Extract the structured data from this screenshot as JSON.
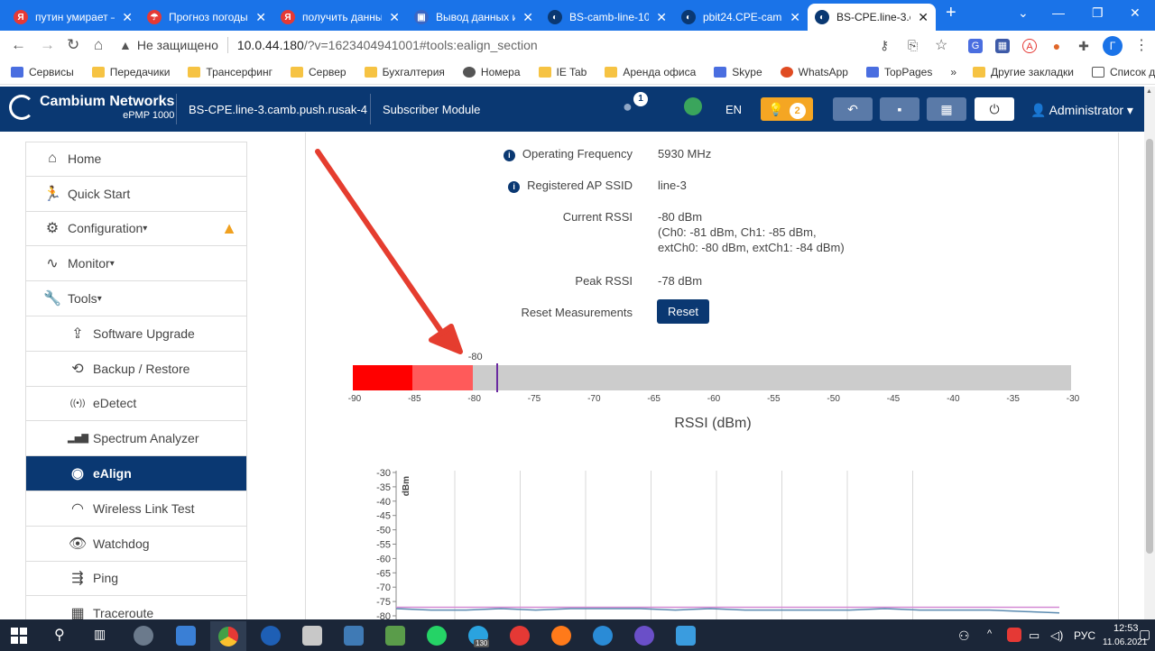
{
  "browser": {
    "tabs": [
      {
        "title": "путин умирает –",
        "icon": "yandex-icon",
        "color": "#e53935"
      },
      {
        "title": "Прогноз погоды",
        "icon": "umbrella-icon",
        "color": "#e53935"
      },
      {
        "title": "получить данны",
        "icon": "yandex-icon",
        "color": "#e53935"
      },
      {
        "title": "Вывод данных и",
        "icon": "site-icon",
        "color": "#3a66c4"
      },
      {
        "title": "BS-camb-line-10",
        "icon": "cambium-icon",
        "color": "#0a3872"
      },
      {
        "title": "pbit24.CPE-camb",
        "icon": "cambium-icon",
        "color": "#0a3872"
      },
      {
        "title": "BS-CPE.line-3.cam",
        "icon": "cambium-icon",
        "color": "#0a3872"
      }
    ],
    "address": {
      "security": "Не защищено",
      "host": "10.0.44.180",
      "path": "/?v=1623404941001#tools:ealign_section"
    },
    "profile_initial": "Г",
    "bookmarks": [
      {
        "label": "Сервисы",
        "icon": "apps-grid-icon"
      },
      {
        "label": "Передачики",
        "icon": "folder-icon"
      },
      {
        "label": "Трансерфинг",
        "icon": "folder-icon"
      },
      {
        "label": "Сервер",
        "icon": "folder-icon"
      },
      {
        "label": "Бухгалтерия",
        "icon": "folder-icon"
      },
      {
        "label": "Номера",
        "icon": "globe-icon"
      },
      {
        "label": "IE Tab",
        "icon": "folder-icon"
      },
      {
        "label": "Аренда офиса",
        "icon": "folder-icon"
      },
      {
        "label": "Skype",
        "icon": "windows-icon"
      },
      {
        "label": "WhatsApp",
        "icon": "alert-circle-icon"
      },
      {
        "label": "TopPages",
        "icon": "apps-grid-icon"
      }
    ],
    "bookmarks_more": "»",
    "bookmarks_other": "Другие закладки",
    "reading_list": "Список для чтения"
  },
  "header": {
    "brand_line1": "Cambium Networks",
    "brand_line2": "ePMP 1000",
    "device_name": "BS-CPE.line-3.camb.push.rusak-4",
    "mode": "Subscriber Module",
    "user_badge": "1",
    "language": "EN",
    "alerts_count": "2",
    "user": "Administrator"
  },
  "sidebar": {
    "items": [
      {
        "label": "Home",
        "icon": "home-icon",
        "level": "top"
      },
      {
        "label": "Quick Start",
        "icon": "running-person-icon",
        "level": "top"
      },
      {
        "label": "Configuration",
        "icon": "gear-icon",
        "level": "top",
        "caret": true,
        "warning": true
      },
      {
        "label": "Monitor",
        "icon": "pulse-icon",
        "level": "top",
        "caret": true
      },
      {
        "label": "Tools",
        "icon": "wrench-icon",
        "level": "top",
        "caret": true
      },
      {
        "label": "Software Upgrade",
        "icon": "upgrade-icon",
        "level": "sub"
      },
      {
        "label": "Backup / Restore",
        "icon": "backup-icon",
        "level": "sub"
      },
      {
        "label": "eDetect",
        "icon": "signal-icon",
        "level": "sub"
      },
      {
        "label": "Spectrum Analyzer",
        "icon": "bar-chart-icon",
        "level": "sub"
      },
      {
        "label": "eAlign",
        "icon": "dish-icon",
        "level": "sub",
        "active": true
      },
      {
        "label": "Wireless Link Test",
        "icon": "gauge-icon",
        "level": "sub"
      },
      {
        "label": "Watchdog",
        "icon": "eye-icon",
        "level": "sub"
      },
      {
        "label": "Ping",
        "icon": "ping-icon",
        "level": "sub"
      },
      {
        "label": "Traceroute",
        "icon": "traceroute-icon",
        "level": "sub"
      }
    ]
  },
  "ealign": {
    "operating_frequency_label": "Operating Frequency",
    "operating_frequency_value": "5930 MHz",
    "ap_ssid_label": "Registered AP SSID",
    "ap_ssid_value": "line-3",
    "current_rssi_label": "Current RSSI",
    "current_rssi_value": "-80 dBm",
    "current_rssi_detail1": "(Ch0: -81 dBm, Ch1: -85 dBm,",
    "current_rssi_detail2": "extCh0: -80 dBm, extCh1: -84 dBm)",
    "peak_rssi_label": "Peak RSSI",
    "peak_rssi_value": "-78 dBm",
    "reset_label": "Reset Measurements",
    "reset_button": "Reset"
  },
  "rssi_gauge": {
    "min": -90,
    "max": -30,
    "current": -80,
    "current_label": "-80",
    "peak": -78,
    "ticks": [
      "-90",
      "-85",
      "-80",
      "-75",
      "-70",
      "-65",
      "-60",
      "-55",
      "-50",
      "-45",
      "-40",
      "-35",
      "-30"
    ],
    "title": "RSSI (dBm)",
    "colors": {
      "strong_red": "#ff0000",
      "light_red": "#ff5a5a",
      "track": "#cccccc",
      "marker": "#6a2aa0"
    }
  },
  "chart_data": {
    "type": "line",
    "ylabel": "dBm",
    "ylim": [
      -80,
      -30
    ],
    "yticks": [
      -30,
      -35,
      -40,
      -45,
      -50,
      -55,
      -60,
      -65,
      -70,
      -75,
      -80
    ],
    "series": [
      {
        "color": "#d48ad4",
        "values": [
          -77,
          -77,
          -77,
          -77,
          -77,
          -77,
          -77,
          -77,
          -77,
          -77,
          -77,
          -77,
          -77,
          -77,
          -77,
          -77,
          -77,
          -77,
          -77,
          -77
        ]
      },
      {
        "color": "#5a8ab0",
        "values": [
          -77.5,
          -78,
          -78,
          -77.5,
          -78,
          -77.5,
          -77.5,
          -77.5,
          -78,
          -77.5,
          -78,
          -78,
          -78,
          -78,
          -77.5,
          -78,
          -78,
          -78,
          -78.5,
          -79
        ]
      }
    ]
  },
  "taskbar": {
    "time": "12:53",
    "date": "11.06.2021",
    "language": "РУС",
    "telegram_badge": "130"
  }
}
